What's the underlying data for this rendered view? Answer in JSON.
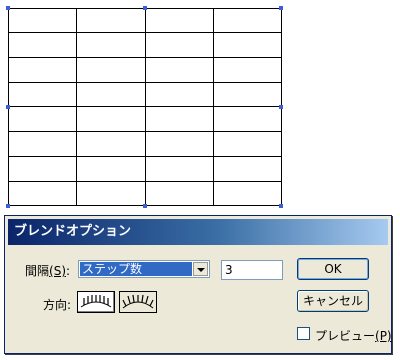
{
  "dialog": {
    "title": "ブレンドオプション",
    "spacing_label": "間隔",
    "spacing_key": "(S)",
    "spacing_value": "ステップ数",
    "steps_value": "3",
    "orientation_label": "方向",
    "ok_label": "OK",
    "cancel_label": "キャンセル",
    "preview_label": "プレビュー",
    "preview_key": "(P)",
    "preview_checked": false
  },
  "icons": {
    "orient_page": "align-to-page-icon",
    "orient_path": "align-to-path-icon"
  },
  "colors": {
    "titlebar_start": "#0a246a",
    "titlebar_end": "#a6caf0",
    "selection": "#3b5fd9",
    "dialog_bg": "#ece9d8"
  }
}
